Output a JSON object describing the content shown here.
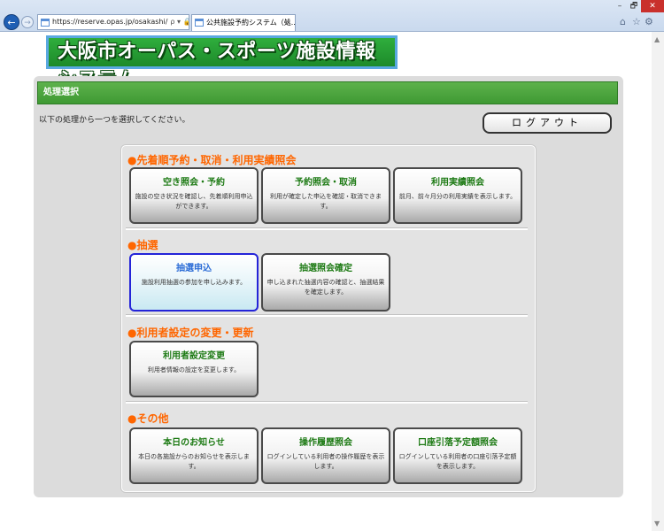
{
  "browser": {
    "url": "https://reserve.opas.jp/osakashi/",
    "address_tools": "ρ ▾ 🔒 C",
    "tab_title": "公共施設予約システム（処...",
    "tab_close": "×",
    "window_controls": {
      "minimize": "–",
      "maximize": "🗗",
      "close": "✕"
    }
  },
  "logo_text": "大阪市オーパス・スポーツ施設情報システム",
  "header_bar": "処理選択",
  "instruction": "以下の処理から一つを選択してください。",
  "logout_label": "ログアウト",
  "sections": [
    {
      "heading": "●先着順予約・取消・利用実績照会",
      "cards": [
        {
          "title": "空き照会・予約",
          "desc": "施設の空き状況を確認し、先着順利用申込ができます。"
        },
        {
          "title": "予約照会・取消",
          "desc": "利用が確定した申込を確認・取消できます。"
        },
        {
          "title": "利用実績照会",
          "desc": "前月、前々月分の利用実績を表示します。"
        }
      ]
    },
    {
      "heading": "●抽選",
      "cards": [
        {
          "title": "抽選申込",
          "desc": "施設利用抽選の参加を申し込みます。"
        },
        {
          "title": "抽選照会確定",
          "desc": "申し込まれた抽選内容の確認と、抽選結果を確定します。"
        }
      ]
    },
    {
      "heading": "●利用者設定の変更・更新",
      "cards": [
        {
          "title": "利用者設定変更",
          "desc": "利用者情報の設定を変更します。"
        }
      ]
    },
    {
      "heading": "●その他",
      "cards": [
        {
          "title": "本日のお知らせ",
          "desc": "本日の各施設からのお知らせを表示します。"
        },
        {
          "title": "操作履歴照会",
          "desc": "ログインしている利用者の操作履歴を表示します。"
        },
        {
          "title": "口座引落予定額照会",
          "desc": "ログインしている利用者の口座引落予定額を表示します。"
        }
      ]
    }
  ],
  "colors": {
    "accent_green": "#3f9a33",
    "section_orange": "#ff6600",
    "active_border": "#2424d8"
  }
}
